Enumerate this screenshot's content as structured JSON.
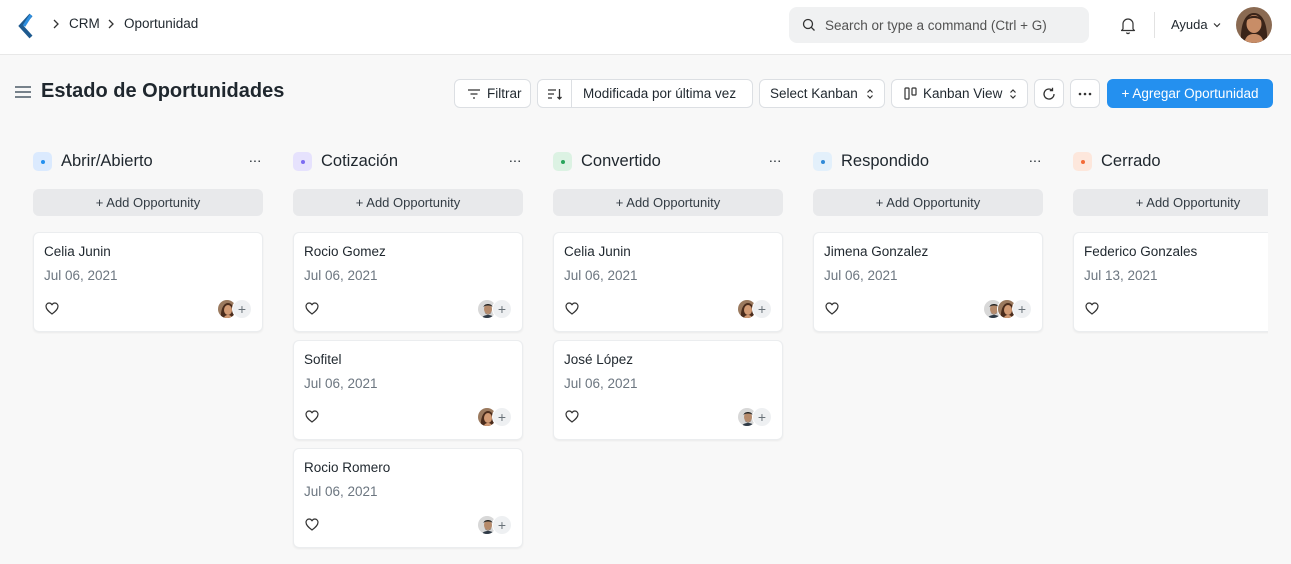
{
  "navbar": {
    "breadcrumbs": [
      "CRM",
      "Oportunidad"
    ],
    "search_placeholder": "Search or type a command (Ctrl + G)",
    "help_label": "Ayuda"
  },
  "page": {
    "title": "Estado de Oportunidades",
    "filter_label": "Filtrar",
    "sort_label": "Modificada por última vez",
    "select_kanban_label": "Select Kanban",
    "view_label": "Kanban View",
    "add_label": "+ Agregar Oportunidad"
  },
  "colors": {
    "primary": "#2490ef"
  },
  "columns": [
    {
      "title": "Abrir/Abierto",
      "indicator_bg": "#dbeafe",
      "indicator_dot": "#2490ef",
      "add_label": "+ Add Opportunity",
      "menu": "···",
      "cards": [
        {
          "title": "Celia Junin",
          "date": "Jul 06, 2021",
          "avatars": [
            "woman"
          ]
        }
      ]
    },
    {
      "title": "Cotización",
      "indicator_bg": "#e6e2fd",
      "indicator_dot": "#7c6cf2",
      "add_label": "+ Add Opportunity",
      "menu": "···",
      "cards": [
        {
          "title": "Rocio Gomez",
          "date": "Jul 06, 2021",
          "avatars": [
            "man"
          ]
        },
        {
          "title": "Sofitel",
          "date": "Jul 06, 2021",
          "avatars": [
            "woman"
          ]
        },
        {
          "title": "Rocio Romero",
          "date": "Jul 06, 2021",
          "avatars": [
            "man"
          ]
        }
      ]
    },
    {
      "title": "Convertido",
      "indicator_bg": "#dcf2e3",
      "indicator_dot": "#29a55c",
      "add_label": "+ Add Opportunity",
      "menu": "···",
      "cards": [
        {
          "title": "Celia Junin",
          "date": "Jul 06, 2021",
          "avatars": [
            "woman"
          ]
        },
        {
          "title": "José López",
          "date": "Jul 06, 2021",
          "avatars": [
            "man"
          ]
        }
      ]
    },
    {
      "title": "Respondido",
      "indicator_bg": "#e3f0fb",
      "indicator_dot": "#318ad8",
      "add_label": "+ Add Opportunity",
      "menu": "···",
      "cards": [
        {
          "title": "Jimena Gonzalez",
          "date": "Jul 06, 2021",
          "avatars": [
            "man",
            "woman"
          ]
        }
      ]
    },
    {
      "title": "Cerrado",
      "indicator_bg": "#fde7dc",
      "indicator_dot": "#f36b38",
      "add_label": "+ Add Opportunity",
      "menu": "",
      "cards": [
        {
          "title": "Federico Gonzales",
          "date": "Jul 13, 2021",
          "avatars": []
        }
      ]
    }
  ]
}
